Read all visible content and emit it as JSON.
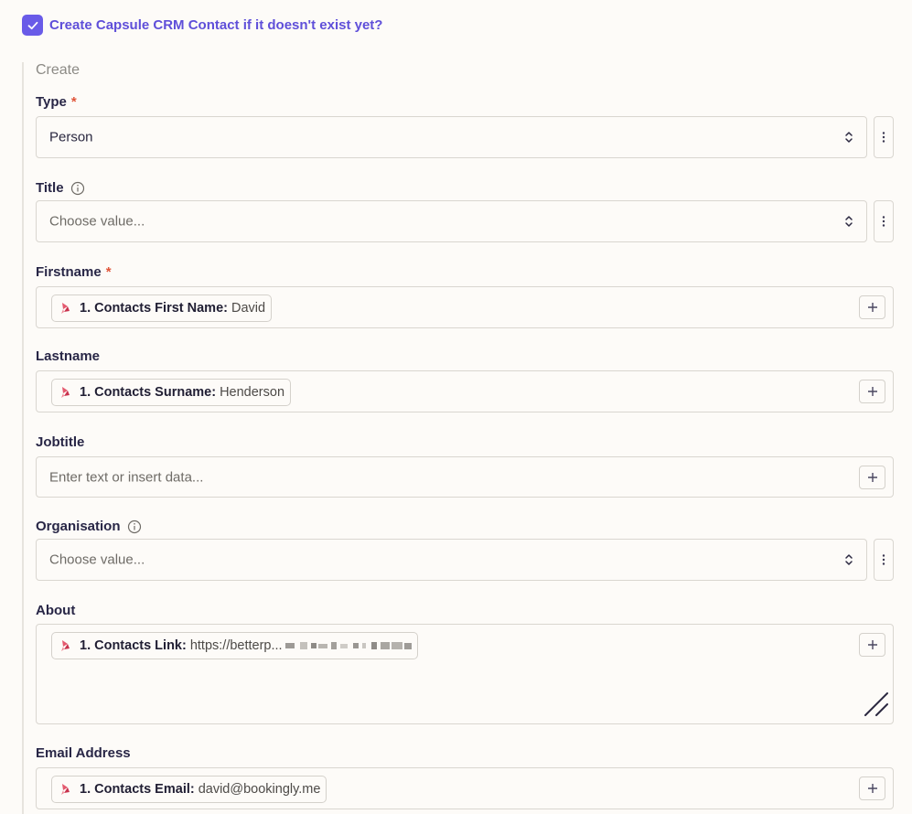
{
  "checkbox": {
    "label": "Create Capsule CRM Contact if it doesn't exist yet?",
    "checked": true
  },
  "section_title": "Create",
  "fields": {
    "type": {
      "label": "Type",
      "required_mark": "*",
      "value": "Person"
    },
    "title": {
      "label": "Title",
      "placeholder": "Choose value..."
    },
    "firstname": {
      "label": "Firstname",
      "required_mark": "*",
      "pill_label": "1. Contacts First Name:",
      "pill_value": "David"
    },
    "lastname": {
      "label": "Lastname",
      "pill_label": "1. Contacts Surname:",
      "pill_value": "Henderson"
    },
    "jobtitle": {
      "label": "Jobtitle",
      "placeholder": "Enter text or insert data..."
    },
    "organisation": {
      "label": "Organisation",
      "placeholder": "Choose value..."
    },
    "about": {
      "label": "About",
      "pill_label": "1. Contacts Link:",
      "pill_value": "https://betterp..."
    },
    "email": {
      "label": "Email Address",
      "pill_label": "1. Contacts Email:",
      "pill_value": "david@bookingly.me"
    }
  },
  "icons": {
    "checkbox": "checkmark-icon",
    "info": "info-icon",
    "select": "chevron-up-down-icon",
    "more": "vertical-dots-icon",
    "insert": "plus-icon",
    "app": "app-logo-icon",
    "resize": "resize-handle-icon"
  },
  "colors": {
    "accent": "#695be8",
    "accent_text": "#5f4fd9",
    "required": "#e0553a",
    "background": "#fdfbf8",
    "border": "#d9d6d0"
  }
}
